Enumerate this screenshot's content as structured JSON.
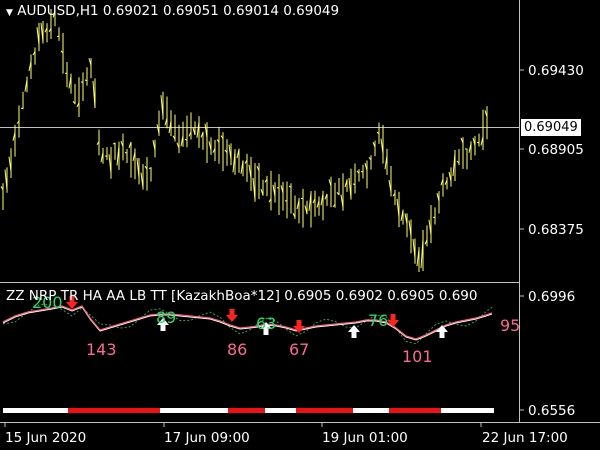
{
  "main": {
    "symbol_text": "AUDUSD,H1",
    "ohlc_text": "0.69021 0.69051 0.69014 0.69049",
    "price_labels": [
      "0.69430",
      "0.68905",
      "0.68375"
    ],
    "current_price": "0.69049"
  },
  "sub": {
    "indicator_text": "ZZ NRP TR HA AA LB TT [KazakhBoa*12]",
    "values_text": "0.6905 0.6902 0.6905 0.690",
    "price_labels": [
      "0.6996",
      "0.6556"
    ],
    "zigzag_labels": [
      {
        "text": "200",
        "color": "#22dd66"
      },
      {
        "text": "143",
        "color": "#ff6699"
      },
      {
        "text": "89",
        "color": "#22dd66"
      },
      {
        "text": "86",
        "color": "#ff6699"
      },
      {
        "text": "63",
        "color": "#22dd66"
      },
      {
        "text": "67",
        "color": "#ff6699"
      },
      {
        "text": "76",
        "color": "#22dd66"
      },
      {
        "text": "101",
        "color": "#ff6699"
      },
      {
        "text": "95",
        "color": "#ff6699"
      }
    ]
  },
  "time_labels": [
    "15 Jun 2020",
    "17 Jun 09:00",
    "19 Jun 01:00",
    "22 Jun 17:00"
  ],
  "colors": {
    "background": "#000000",
    "candles": "#ffff66",
    "grid": "#c0c0c0",
    "up_arrow": "#ffffff",
    "down_arrow": "#ff2222",
    "line_main": "#ff6680",
    "line_signal": "#ffffff",
    "dots": "#22aa55",
    "bar_red": "#ee1111",
    "bar_white": "#ffffff"
  }
}
